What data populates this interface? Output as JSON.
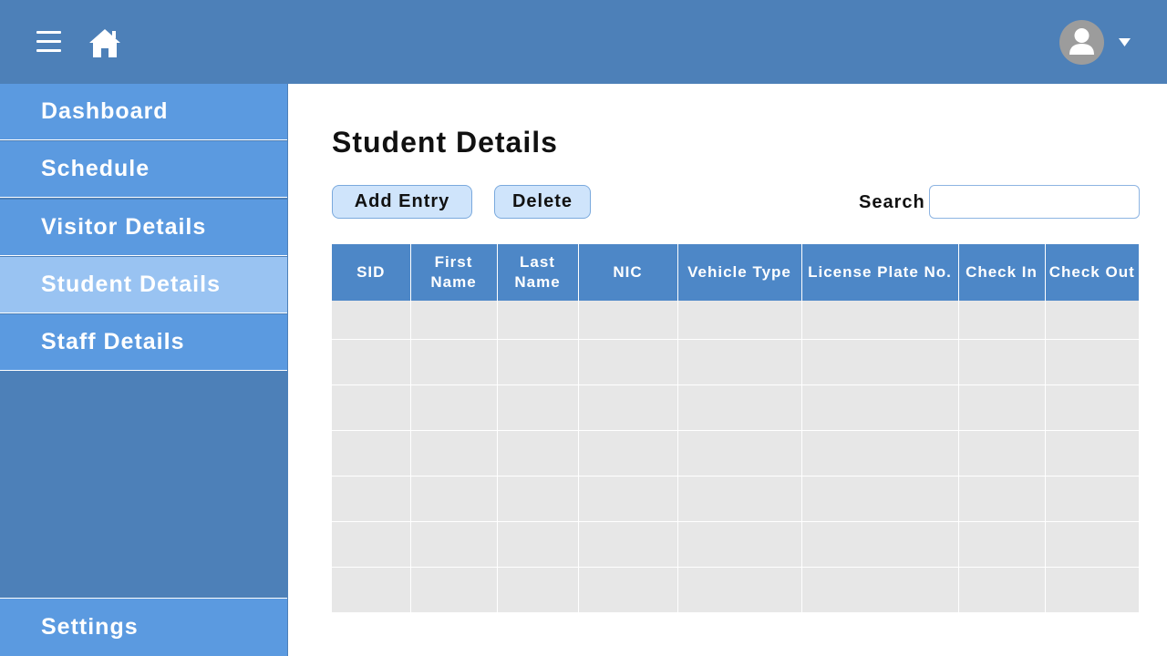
{
  "header": {
    "menu_icon": "hamburger-menu-icon",
    "home_icon": "home-icon",
    "avatar_icon": "user-avatar-icon",
    "dropdown_icon": "caret-down-icon"
  },
  "sidebar": {
    "items": [
      {
        "label": "Dashboard"
      },
      {
        "label": "Schedule"
      },
      {
        "label": "Visitor Details"
      },
      {
        "label": "Student Details",
        "active": true
      },
      {
        "label": "Staff Details"
      }
    ],
    "settings_label": "Settings"
  },
  "main": {
    "title": "Student Details",
    "add_entry_label": "Add Entry",
    "delete_label": "Delete",
    "search_label": "Search",
    "search_value": "",
    "table": {
      "columns": [
        "SID",
        "First Name",
        "Last Name",
        "NIC",
        "Vehicle Type",
        "License Plate No.",
        "Check In",
        "Check Out"
      ],
      "rows": [
        [
          "",
          "",
          "",
          "",
          "",
          "",
          "",
          ""
        ],
        [
          "",
          "",
          "",
          "",
          "",
          "",
          "",
          ""
        ],
        [
          "",
          "",
          "",
          "",
          "",
          "",
          "",
          ""
        ],
        [
          "",
          "",
          "",
          "",
          "",
          "",
          "",
          ""
        ],
        [
          "",
          "",
          "",
          "",
          "",
          "",
          "",
          ""
        ],
        [
          "",
          "",
          "",
          "",
          "",
          "",
          "",
          ""
        ],
        [
          "",
          "",
          "",
          "",
          "",
          "",
          "",
          ""
        ]
      ]
    }
  },
  "colors": {
    "topbar": "#4d80b8",
    "nav_item": "#5b9ae0",
    "nav_active": "#99c3f2",
    "table_header": "#4d87c7",
    "table_cell": "#e7e7e7",
    "button": "#cfe4fb"
  }
}
